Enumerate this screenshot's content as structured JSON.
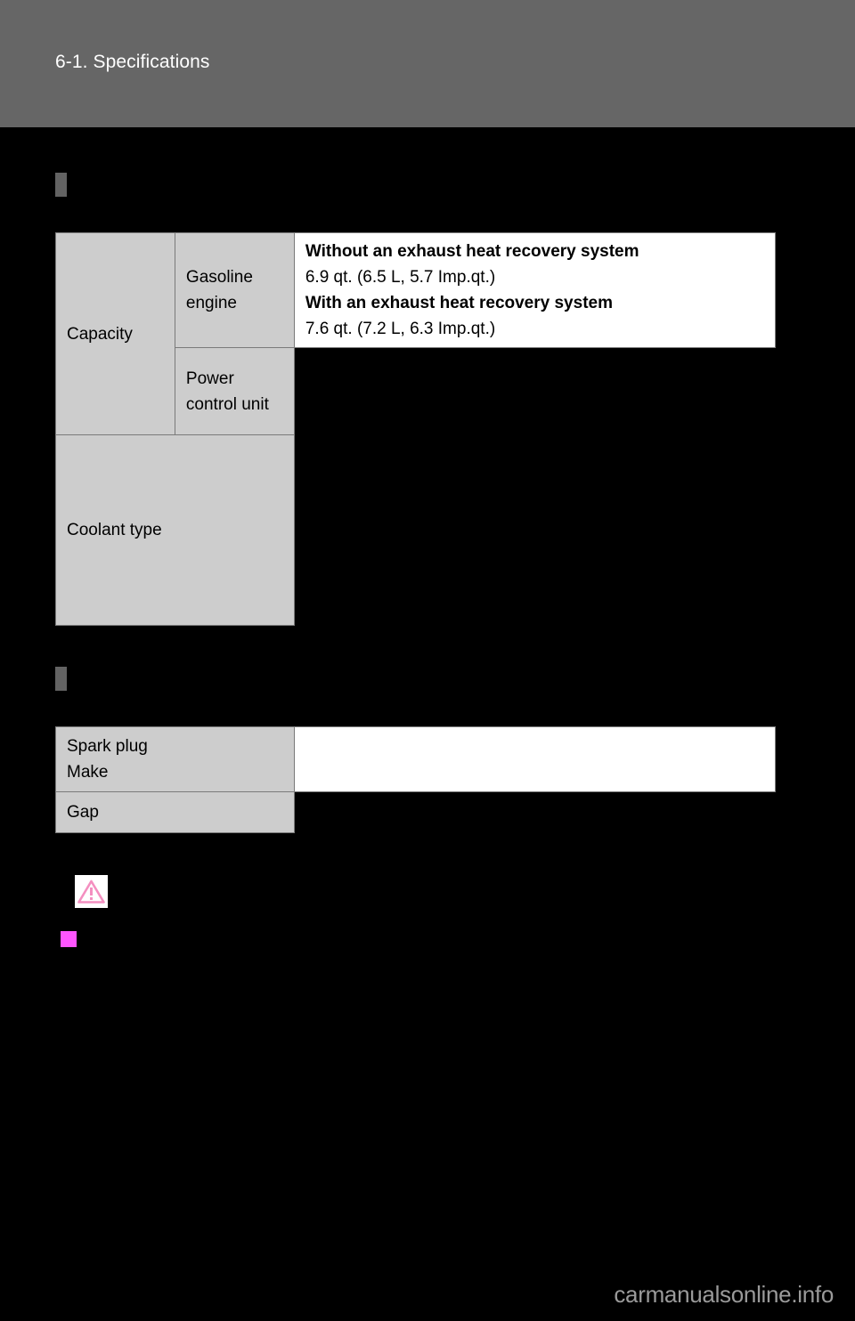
{
  "page": {
    "background_color": "#000000",
    "header": {
      "band_color": "#666666",
      "title": "6-1. Specifications"
    },
    "footer": {
      "watermark": "carmanualsonline.info",
      "color": "#9a9a9a"
    }
  },
  "sections": [
    {
      "marker_color": "#636363",
      "heading": "",
      "table": {
        "rows": [
          {
            "label_a": "Capacity",
            "label_b": "Gasoline engine",
            "value_lines": [
              {
                "text": "Without an exhaust heat recovery system",
                "bold": true
              },
              {
                "text": "6.9 qt. (6.5 L, 5.7 Imp.qt.)",
                "bold": false
              },
              {
                "text": "With an exhaust heat recovery system",
                "bold": true
              },
              {
                "text": "7.6 qt. (7.2 L, 6.3 Imp.qt.)",
                "bold": false
              }
            ]
          },
          {
            "label_b": "Power control unit",
            "value_lines": []
          },
          {
            "label_a": "Coolant type",
            "value_lines": []
          }
        ]
      }
    },
    {
      "marker_color": "#636363",
      "heading": "",
      "table": {
        "rows": [
          {
            "label_a": "Spark plug\nMake",
            "value_lines": []
          },
          {
            "label_a": "Gap",
            "value_lines": []
          }
        ]
      }
    }
  ],
  "notices": {
    "warning": {
      "icon": "warning-triangle-icon",
      "icon_color": "#f48fc0",
      "icon_background": "#ffffff",
      "heading": ""
    },
    "notice": {
      "icon": "square-bullet-icon",
      "icon_color": "#ff55ff",
      "heading": ""
    }
  },
  "table1": {
    "capacity_label": "Capacity",
    "gasoline_engine_label": "Gasoline engine",
    "power_control_unit_label": "Power control unit",
    "coolant_type_label": "Coolant type",
    "value_without_title": "Without an exhaust heat recovery system",
    "value_without_amount": "6.9 qt. (6.5 L, 5.7 Imp.qt.)",
    "value_with_title": "With an exhaust heat recovery system",
    "value_with_amount": "7.6 qt. (7.2 L, 6.3 Imp.qt.)"
  },
  "table2": {
    "spark_plug_make_label_line1": "Spark plug",
    "spark_plug_make_label_line2": "Make",
    "gap_label": "Gap"
  }
}
